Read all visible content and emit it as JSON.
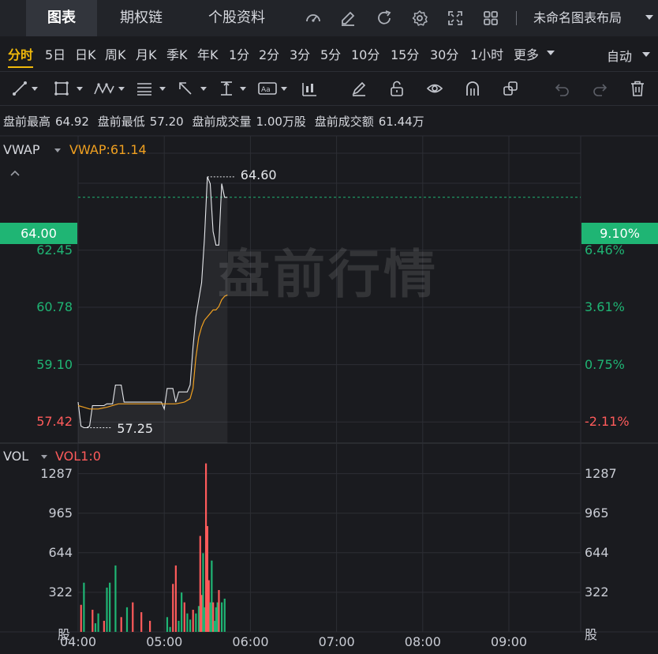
{
  "topbar": {
    "tabs": [
      "图表",
      "期权链",
      "个股资料"
    ],
    "active_tab": 0,
    "icons": [
      "gauge-icon",
      "edit-icon",
      "refresh-icon",
      "settings-icon",
      "fullscreen-icon",
      "grid-icon"
    ],
    "layout_name": "未命名图表布局"
  },
  "periods": {
    "items": [
      "分时",
      "5日",
      "日K",
      "周K",
      "月K",
      "季K",
      "年K",
      "1分",
      "2分",
      "3分",
      "5分",
      "10分",
      "15分",
      "30分",
      "1小时",
      "更多"
    ],
    "active": "分时",
    "auto": "自动"
  },
  "drawing_tools": [
    "trendline-icon",
    "rectangle-icon",
    "pattern-icon",
    "fibonacci-icon",
    "arrow-icon",
    "measure-icon",
    "text-icon",
    "bar-pattern-icon",
    "brush-icon",
    "unlock-icon",
    "eye-icon",
    "magnet-icon",
    "clone-icon",
    "undo-icon",
    "redo-icon",
    "trash-icon"
  ],
  "premarket": {
    "high_label": "盘前最高",
    "high": "64.92",
    "low_label": "盘前最低",
    "low": "57.20",
    "volume_label": "盘前成交量",
    "volume": "1.00万股",
    "amount_label": "盘前成交额",
    "amount": "61.44万"
  },
  "indicator": {
    "name": "VWAP",
    "value_label": "VWAP:61.14"
  },
  "vol_indicator": {
    "name": "VOL",
    "value_label": "VOL1:0"
  },
  "watermark": "盘前行情",
  "colors": {
    "up": "#ff5b5b",
    "down": "#1fb574",
    "vwap": "#f0a020",
    "accent": "#f0b90b"
  },
  "chart_data": [
    {
      "type": "line",
      "series": [
        {
          "name": "",
          "x": [
            "04:00",
            "04:02",
            "04:04",
            "04:06",
            "04:08",
            "04:10",
            "04:12",
            "04:14",
            "04:16",
            "04:18",
            "04:20",
            "04:22",
            "04:24",
            "04:26",
            "04:28",
            "04:30",
            "04:32",
            "04:34",
            "04:36",
            "04:38",
            "04:40",
            "04:42",
            "04:44",
            "04:46",
            "04:48",
            "04:50",
            "04:52",
            "04:54",
            "04:56",
            "04:58",
            "05:00",
            "05:02",
            "05:04",
            "05:06",
            "05:08",
            "05:10",
            "05:12",
            "05:14",
            "05:16",
            "05:18",
            "05:20",
            "05:22",
            "05:24",
            "05:26",
            "05:28",
            "05:30",
            "05:32",
            "05:34",
            "05:36",
            "05:38",
            "05:40",
            "05:42",
            "05:44"
          ],
          "values": [
            58.0,
            57.3,
            57.25,
            57.25,
            57.3,
            57.9,
            57.9,
            57.9,
            57.9,
            57.9,
            57.95,
            57.95,
            57.95,
            58.5,
            58.5,
            58.5,
            58.0,
            58.0,
            58.0,
            58.0,
            58.0,
            58.0,
            58.0,
            58.0,
            58.0,
            58.0,
            58.0,
            58.0,
            58.0,
            58.0,
            57.8,
            58.4,
            58.4,
            58.4,
            58.0,
            58.3,
            58.3,
            58.3,
            58.3,
            58.5,
            59.6,
            60.5,
            61.0,
            61.5,
            62.8,
            64.6,
            64.4,
            63.0,
            62.6,
            62.6,
            64.4,
            64.0,
            64.0
          ]
        },
        {
          "name": "",
          "x": [
            "04:00",
            "04:04",
            "04:08",
            "04:14",
            "04:20",
            "04:28",
            "04:34",
            "04:40",
            "04:50",
            "05:00",
            "05:08",
            "05:14",
            "05:18",
            "05:20",
            "05:22",
            "05:24",
            "05:26",
            "05:28",
            "05:30",
            "05:32",
            "05:34",
            "05:36",
            "05:38",
            "05:40",
            "05:42",
            "05:44"
          ],
          "values": [
            57.9,
            57.85,
            57.8,
            57.8,
            57.85,
            57.95,
            57.95,
            57.95,
            57.95,
            57.95,
            57.95,
            58.0,
            58.1,
            58.4,
            59.3,
            59.9,
            60.2,
            60.4,
            60.5,
            60.6,
            60.7,
            60.7,
            60.8,
            61.0,
            61.1,
            61.14
          ]
        }
      ],
      "y_ticks": [
        "64.00",
        "62.45",
        "60.78",
        "59.10",
        "57.42"
      ],
      "pct_ticks": [
        "9.10%",
        "6.46%",
        "3.61%",
        "0.75%",
        "-2.11%"
      ],
      "ylim": [
        56.8,
        65.8
      ],
      "baseline": 58.66,
      "current_price": 64.0,
      "high_marker": {
        "label": "64.60",
        "value": 64.6
      },
      "low_marker": {
        "label": "57.25",
        "value": 57.25
      },
      "x_ticks": [
        "04:00",
        "05:00",
        "06:00",
        "07:00",
        "08:00",
        "09:00"
      ],
      "xlim": [
        "04:00",
        "09:50"
      ]
    },
    {
      "type": "bar",
      "x": [
        "04:02",
        "04:04",
        "04:10",
        "04:12",
        "04:14",
        "04:18",
        "04:20",
        "04:22",
        "04:26",
        "04:30",
        "04:34",
        "04:38",
        "04:44",
        "04:50",
        "05:02",
        "05:04",
        "05:06",
        "05:08",
        "05:10",
        "05:12",
        "05:14",
        "05:16",
        "05:18",
        "05:20",
        "05:22",
        "05:24",
        "05:25",
        "05:26",
        "05:27",
        "05:28",
        "05:29",
        "05:30",
        "05:31",
        "05:32",
        "05:33",
        "05:34",
        "05:35",
        "05:36",
        "05:37",
        "05:38",
        "05:40",
        "05:42"
      ],
      "values": [
        220,
        400,
        180,
        70,
        150,
        90,
        360,
        400,
        540,
        120,
        200,
        240,
        160,
        90,
        120,
        40,
        390,
        540,
        90,
        320,
        240,
        150,
        100,
        180,
        150,
        210,
        780,
        300,
        640,
        200,
        1370,
        860,
        420,
        240,
        580,
        240,
        90,
        200,
        240,
        340,
        240,
        270
      ],
      "up": [
        1,
        0,
        1,
        0,
        0,
        1,
        0,
        0,
        0,
        1,
        0,
        1,
        1,
        1,
        0,
        0,
        1,
        1,
        0,
        0,
        1,
        0,
        0,
        1,
        0,
        0,
        1,
        1,
        0,
        0,
        1,
        1,
        1,
        0,
        0,
        1,
        0,
        0,
        0,
        1,
        0,
        0
      ],
      "y_ticks": [
        "1287",
        "965",
        "644",
        "322"
      ],
      "unit": "股",
      "ylim": [
        0,
        1400
      ]
    }
  ]
}
